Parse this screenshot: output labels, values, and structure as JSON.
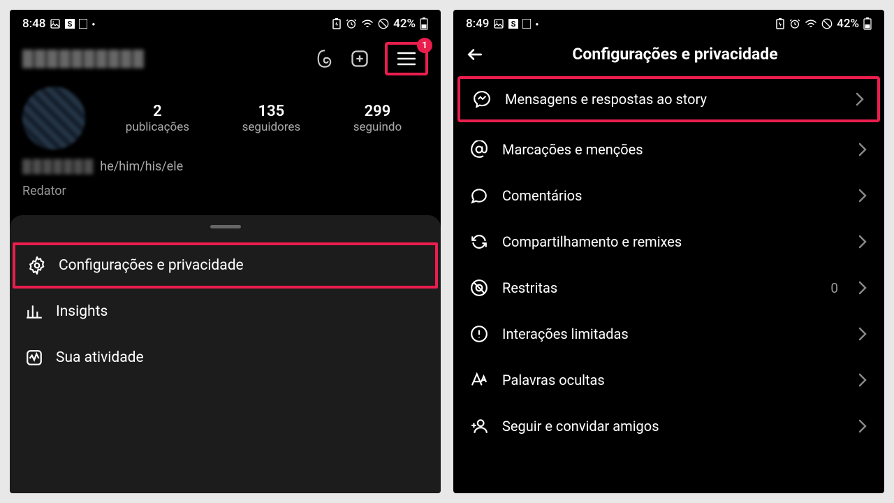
{
  "left": {
    "status": {
      "time": "8:48",
      "battery": "42%"
    },
    "header": {
      "notif_count": "1"
    },
    "stats": [
      {
        "value": "2",
        "label": "publicações"
      },
      {
        "value": "135",
        "label": "seguidores"
      },
      {
        "value": "299",
        "label": "seguindo"
      }
    ],
    "pronouns": "he/him/his/ele",
    "occupation": "Redator",
    "menu": [
      {
        "label": "Configurações e privacidade"
      },
      {
        "label": "Insights"
      },
      {
        "label": "Sua atividade"
      }
    ]
  },
  "right": {
    "status": {
      "time": "8:49",
      "battery": "42%"
    },
    "title": "Configurações e privacidade",
    "items": [
      {
        "label": "Mensagens e respostas ao story"
      },
      {
        "label": "Marcações e menções"
      },
      {
        "label": "Comentários"
      },
      {
        "label": "Compartilhamento e remixes"
      },
      {
        "label": "Restritas",
        "extra": "0"
      },
      {
        "label": "Interações limitadas"
      },
      {
        "label": "Palavras ocultas"
      },
      {
        "label": "Seguir e convidar amigos"
      }
    ]
  }
}
